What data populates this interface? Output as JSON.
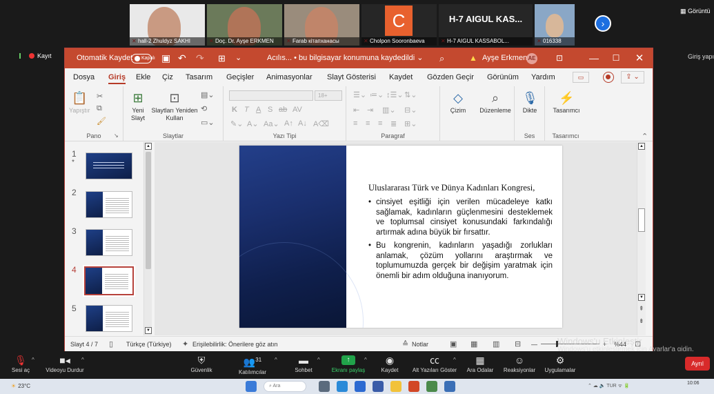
{
  "zoom": {
    "participants": [
      {
        "name": "hall-2 Zhuldyz SAKHI",
        "face_color": "#c99a82",
        "bg_color": "#e9e9e9"
      },
      {
        "name": "Doç. Dr. Ayşe ERKMEN",
        "face_color": "#b07458",
        "bg_color": "#6b7a5a"
      },
      {
        "name": "Farab кітапханасы",
        "face_color": "#c0856a",
        "bg_color": "#9a8c7c"
      },
      {
        "name": "Cholpon Sooronbaeva",
        "avatar_letter": "C",
        "avatar_color": "#e8612e"
      },
      {
        "name": "H-7 AIGUL KASSABOL...",
        "display": "H-7  AIGUL  KAS..."
      },
      {
        "name": "016338",
        "face_color": "#d7b79a",
        "bg_color": "#8aa7c6"
      }
    ],
    "view_label": "Görüntü",
    "recording_label": "Kayıt",
    "login_hint": "Giriş yapı",
    "toolbar": {
      "audio": "Sesi aç",
      "video": "Videoyu Durdur",
      "security": "Güvenlik",
      "participants": "Katılımcılar",
      "participants_count": "31",
      "chat": "Sohbet",
      "share": "Ekranı paylaş",
      "record": "Kaydet",
      "captions": "Alt Yazıları Göster",
      "breakout": "Ara Odalar",
      "reactions": "Reaksiyonlar",
      "apps": "Uygulamalar",
      "leave": "Ayrıl"
    }
  },
  "ppt": {
    "titlebar": {
      "autosave": "Otomatik Kaydet",
      "autosave_state": "Kapalı",
      "doc_title": "Acılıs... • bu bilgisayar konumuna kaydedildi ⌄",
      "user": "Ayşe Erkmen",
      "user_initials": "AE"
    },
    "tabs": [
      "Dosya",
      "Giriş",
      "Ekle",
      "Çiz",
      "Tasarım",
      "Geçişler",
      "Animasyonlar",
      "Slayt Gösterisi",
      "Kaydet",
      "Gözden Geçir",
      "Görünüm",
      "Yardım"
    ],
    "active_tab": "Giriş",
    "ribbon": {
      "paste": "Yapıştır",
      "clipboard_group": "Pano",
      "new_slide": "Yeni Slayt",
      "reuse_slides": "Slaytları Yeniden Kullan",
      "slides_group": "Slaytlar",
      "font_size": "18+",
      "font_group": "Yazı Tipi",
      "paragraph_group": "Paragraf",
      "drawing": "Çizim",
      "editing": "Düzenleme",
      "dictate": "Dikte",
      "voice_group": "Ses",
      "designer": "Tasarımcı",
      "designer_group": "Tasarımcı"
    },
    "slides": [
      {
        "num": "1",
        "star": "*",
        "kind": "title"
      },
      {
        "num": "2",
        "kind": "content"
      },
      {
        "num": "3",
        "kind": "content"
      },
      {
        "num": "4",
        "kind": "content",
        "selected": true
      },
      {
        "num": "5",
        "kind": "content"
      }
    ],
    "current_slide": {
      "heading": "Uluslararası Türk ve Dünya Kadınları Kongresi,",
      "bullets": [
        "cinsiyet eşitliği için verilen mücadeleye katkı sağlamak, kadınların güçlenmesini desteklemek ve toplumsal cinsiyet konusundaki farkındalığı artırmak adına büyük bir fırsattır.",
        "Bu kongrenin, kadınların yaşadığı zorlukları anlamak, çözüm yollarını araştırmak ve toplumumuzda gerçek bir değişim yaratmak için önemli bir adım olduğuna inanıyorum."
      ]
    },
    "status": {
      "slide_pos": "Slayt 4 / 7",
      "language": "Türkçe (Türkiye)",
      "accessibility": "Erişilebilirlik: Önerilere göz atın",
      "notes": "Notlar",
      "zoom": "%44"
    }
  },
  "windows": {
    "activate_title": "Windows'u Etkinleştir",
    "activate_text": "Windows'u etkinleştirmek için Ayarlar'a gidin.",
    "weather": "23°C",
    "search": "Ara",
    "tray": "TUR",
    "time": "10:06"
  }
}
